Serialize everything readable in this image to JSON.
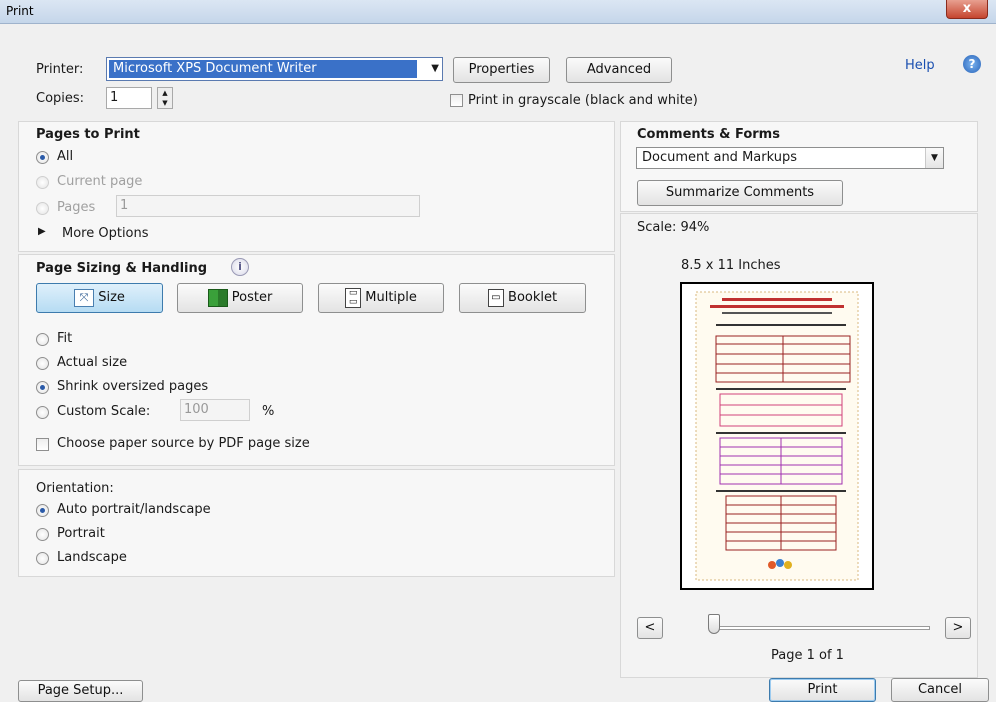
{
  "window": {
    "title": "Print",
    "close": "x"
  },
  "printer": {
    "label": "Printer:",
    "value": "Microsoft XPS Document Writer",
    "properties": "Properties",
    "advanced": "Advanced",
    "help": "Help"
  },
  "copies": {
    "label": "Copies:",
    "value": "1"
  },
  "grayscale": {
    "label": "Print in grayscale (black and white)"
  },
  "pages_to_print": {
    "title": "Pages to Print",
    "all": "All",
    "current": "Current page",
    "pages": "Pages",
    "pages_value": "1",
    "more_options": "More Options"
  },
  "sizing": {
    "title": "Page Sizing & Handling",
    "size": "Size",
    "poster": "Poster",
    "multiple": "Multiple",
    "booklet": "Booklet",
    "fit": "Fit",
    "actual": "Actual size",
    "shrink": "Shrink oversized pages",
    "custom": "Custom Scale:",
    "custom_value": "100",
    "percent": "%",
    "paper_source": "Choose paper source by PDF page size"
  },
  "orientation": {
    "title": "Orientation:",
    "auto": "Auto portrait/landscape",
    "portrait": "Portrait",
    "landscape": "Landscape"
  },
  "comments": {
    "title": "Comments & Forms",
    "value": "Document and Markups",
    "summarize": "Summarize Comments"
  },
  "preview": {
    "scale": "Scale: 94%",
    "paper": "8.5 x 11 Inches",
    "prev": "<",
    "next": ">",
    "page_info": "Page 1 of 1"
  },
  "footer": {
    "page_setup": "Page Setup...",
    "print": "Print",
    "cancel": "Cancel"
  }
}
